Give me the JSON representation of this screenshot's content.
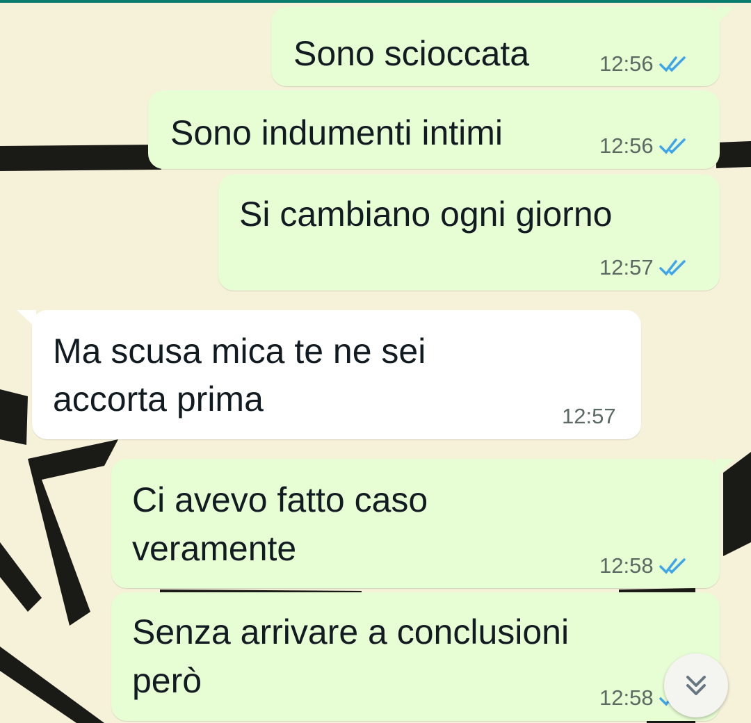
{
  "chat": {
    "messages": [
      {
        "direction": "out",
        "text_lines": [
          "Sono scioccata"
        ],
        "time": "12:56",
        "status": "read"
      },
      {
        "direction": "out",
        "text_lines": [
          "Sono indumenti intimi"
        ],
        "time": "12:56",
        "status": "read"
      },
      {
        "direction": "out",
        "text_lines": [
          "Si cambiano ogni giorno"
        ],
        "time": "12:57",
        "status": "read"
      },
      {
        "direction": "in",
        "text_lines": [
          "Ma scusa mica te ne sei",
          "accorta prima"
        ],
        "time": "12:57"
      },
      {
        "direction": "out",
        "text_lines": [
          "Ci avevo fatto caso",
          "veramente"
        ],
        "time": "12:58",
        "status": "read"
      },
      {
        "direction": "out",
        "text_lines": [
          "Senza arrivare a conclusioni",
          "però"
        ],
        "time": "12:58",
        "status": "read"
      }
    ]
  },
  "icons": {
    "read_receipt": "double-check-icon",
    "scroll_down": "double-chevron-down-icon"
  },
  "colors": {
    "outgoing_bubble": "#e7fdd3",
    "incoming_bubble": "#ffffff",
    "read_tick": "#3fa5e8",
    "accent": "#0a7c6b"
  }
}
